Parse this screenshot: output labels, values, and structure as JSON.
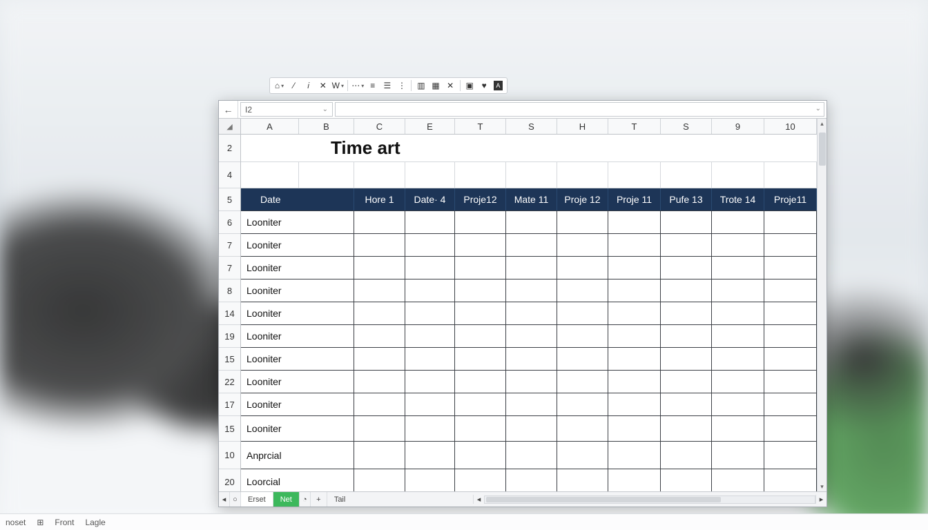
{
  "toolbar": {
    "icons": [
      "home",
      "caret",
      "italic",
      "shuffle",
      "font-w",
      "more",
      "align-left",
      "align-justify",
      "chart",
      "table",
      "close",
      "border",
      "heart",
      "fill"
    ]
  },
  "name_box": {
    "value": "I2"
  },
  "columns": [
    {
      "label": "A",
      "w": 84
    },
    {
      "label": "B",
      "w": 80
    },
    {
      "label": "C",
      "w": 74
    },
    {
      "label": "E",
      "w": 72
    },
    {
      "label": "T",
      "w": 74
    },
    {
      "label": "S",
      "w": 74
    },
    {
      "label": "H",
      "w": 74
    },
    {
      "label": "T",
      "w": 76
    },
    {
      "label": "S",
      "w": 74
    },
    {
      "label": "9",
      "w": 76
    },
    {
      "label": "10",
      "w": 76
    }
  ],
  "row_numbers": [
    "2",
    "4",
    "5",
    "6",
    "7",
    "7",
    "8",
    "14",
    "19",
    "15",
    "22",
    "17",
    "15",
    "10",
    "20"
  ],
  "title": "Time art",
  "header_row": [
    "Date",
    "Hore 1",
    "Date· 4",
    "Proje12",
    "Mate 11",
    "Proje 12",
    "Proje 11",
    "Pufe 13",
    "Trote 14",
    "Proje11"
  ],
  "data_rows": [
    "Looniter",
    "Looniter",
    "Looniter",
    "Looniter",
    "Looniter",
    "Looniter",
    "Looniter",
    "Looniter",
    "Looniter",
    "Looniter",
    "Anprcial",
    "Loorcial"
  ],
  "tabs": {
    "nav_first": "◂",
    "nav_circle": "○",
    "tab1": "Erset",
    "tab_active": "Net",
    "tab_clock": "◔",
    "add": "+",
    "tab3": "Tail"
  },
  "statusbar": {
    "item1": "noset",
    "item2": "Front",
    "item3": "Lagle"
  }
}
